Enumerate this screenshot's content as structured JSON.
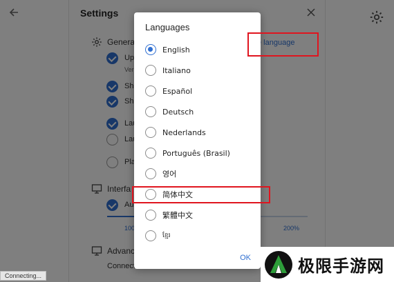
{
  "settings": {
    "title": "Settings",
    "general_label": "Genera",
    "change_language_link": "e language",
    "items": [
      {
        "label": "Up",
        "checked": true
      },
      {
        "sub": "Ver"
      },
      {
        "label": "Sho",
        "checked": true
      },
      {
        "label": "Sho",
        "checked": true
      },
      {
        "label": "Lau",
        "checked": true
      },
      {
        "label": "Lau",
        "checked": false
      },
      {
        "label": "Pla",
        "checked": false
      }
    ],
    "interface_label": "Interfa",
    "interface_item": "Au",
    "zoom_min": "100",
    "zoom_max": "200%",
    "advanced_label": "Advanc",
    "advanced_sub": "Connect"
  },
  "status": {
    "connecting": "Connecting..."
  },
  "dialog": {
    "title": "Languages",
    "ok_label": "OK",
    "languages": [
      {
        "label": "English",
        "selected": true
      },
      {
        "label": "Italiano",
        "selected": false
      },
      {
        "label": "Español",
        "selected": false
      },
      {
        "label": "Deutsch",
        "selected": false
      },
      {
        "label": "Nederlands",
        "selected": false
      },
      {
        "label": "Português (Brasil)",
        "selected": false
      },
      {
        "label": "영어",
        "selected": false
      },
      {
        "label": "简体中文",
        "selected": false
      },
      {
        "label": "繁體中文",
        "selected": false
      },
      {
        "label": "ខ្មែរ",
        "selected": false
      }
    ]
  },
  "watermark": {
    "text": "极限手游网"
  },
  "colors": {
    "accent": "#2f6fd1",
    "highlight": "#e0141e"
  }
}
